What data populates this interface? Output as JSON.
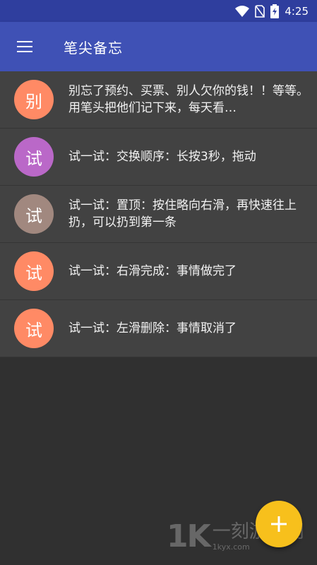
{
  "status_bar": {
    "time": "4:25",
    "icons": [
      "wifi-icon",
      "no-sim-icon",
      "battery-charging-icon"
    ]
  },
  "app_bar": {
    "menu_icon": "hamburger-menu-icon",
    "title": "笔尖备忘"
  },
  "notes": [
    {
      "avatar": "别",
      "color": "#ff8a65",
      "text": "别忘了预约、买票、别人欠你的钱！！等等。用笔头把他们记下来，每天看…"
    },
    {
      "avatar": "试",
      "color": "#ba68c8",
      "text": "试一试：交换顺序：长按3秒，拖动"
    },
    {
      "avatar": "试",
      "color": "#a1887f",
      "text": "试一试：置顶：按住略向右滑，再快速往上扔，可以扔到第一条"
    },
    {
      "avatar": "试",
      "color": "#ff8a65",
      "text": "试一试：右滑完成：事情做完了"
    },
    {
      "avatar": "试",
      "color": "#ff8a65",
      "text": "试一试：左滑删除：事情取消了"
    }
  ],
  "fab": {
    "icon": "plus-icon",
    "color": "#f7c01c"
  },
  "watermark": {
    "logo": "1K",
    "text": "一刻游戏网",
    "url": "1kyx.com"
  },
  "colors": {
    "primary": "#3f51b5",
    "primary_dark": "#2f3e9e",
    "background": "#303030",
    "row": "#424242"
  }
}
